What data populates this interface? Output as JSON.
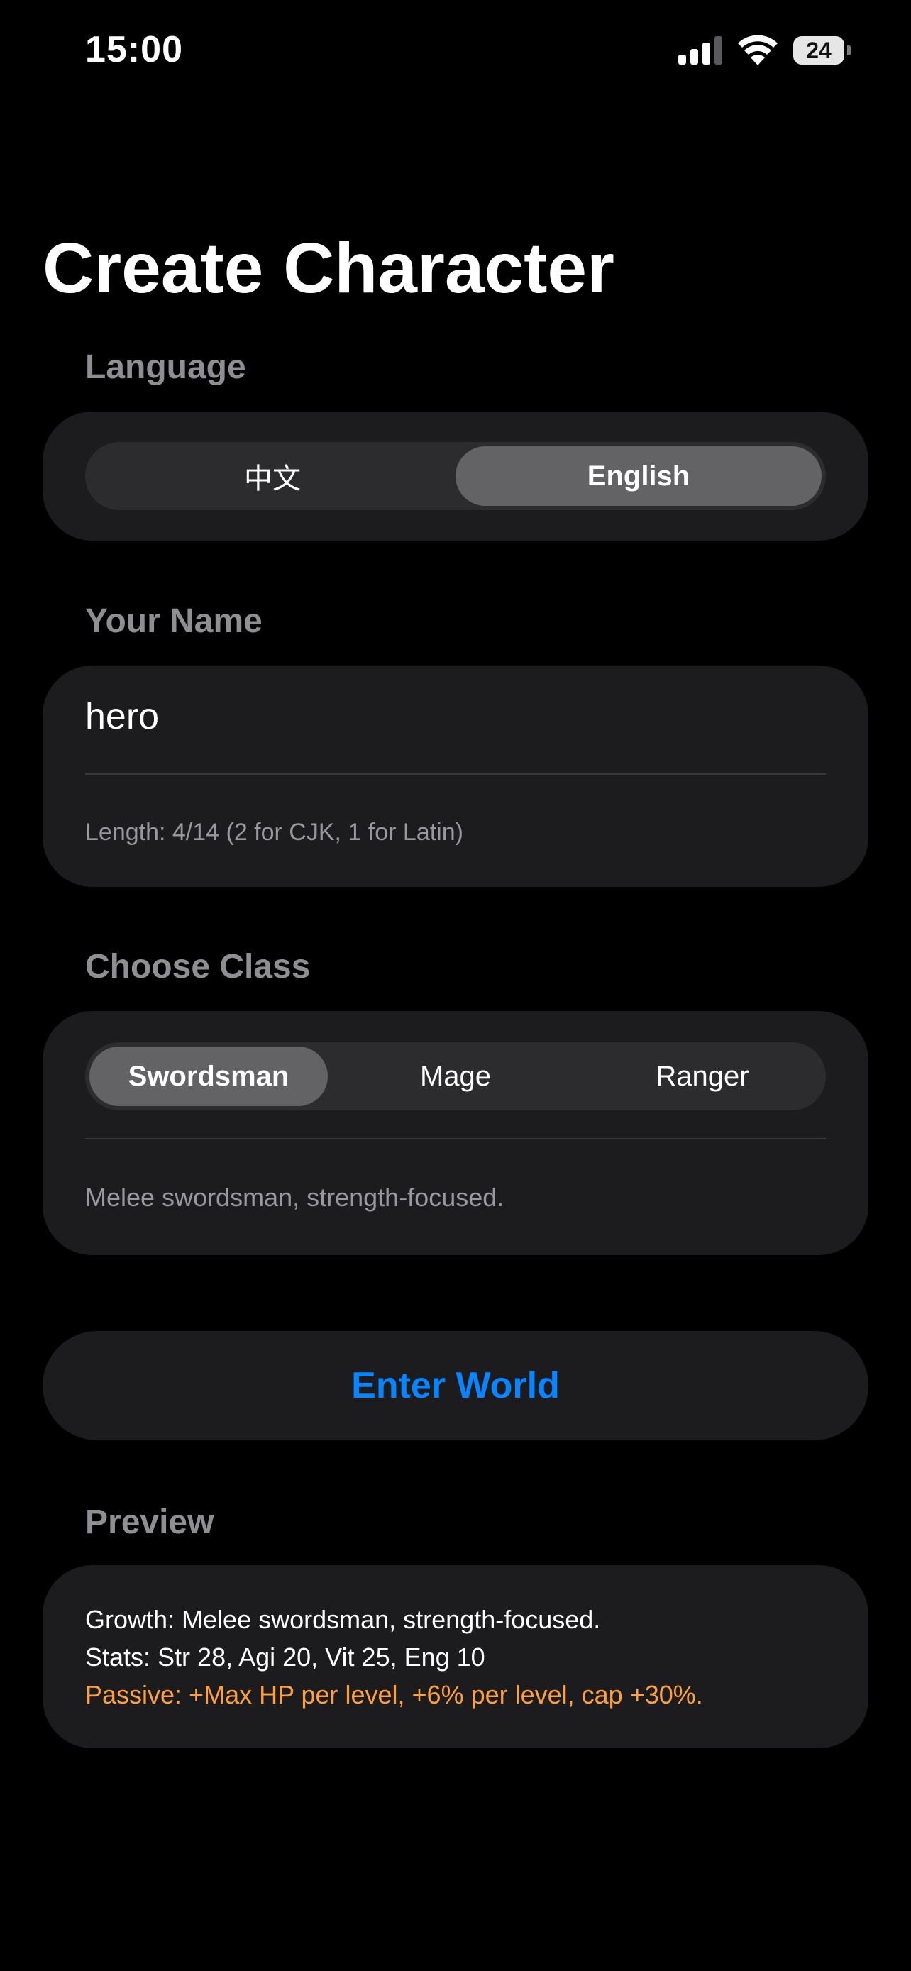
{
  "status_bar": {
    "time": "15:00",
    "battery": "24",
    "icons": [
      "signal-icon",
      "wifi-icon",
      "battery-icon"
    ]
  },
  "title": "Create Character",
  "language": {
    "label": "Language",
    "options": [
      "中文",
      "English"
    ],
    "selected": "English"
  },
  "name": {
    "label": "Your Name",
    "value": "hero",
    "hint": "Length: 4/14 (2 for CJK, 1 for Latin)"
  },
  "class": {
    "label": "Choose Class",
    "options": [
      "Swordsman",
      "Mage",
      "Ranger"
    ],
    "selected": "Swordsman",
    "description": "Melee swordsman, strength-focused."
  },
  "enter_button": {
    "label": "Enter World"
  },
  "preview": {
    "label": "Preview",
    "growth": "Growth: Melee swordsman, strength-focused.",
    "stats": "Stats: Str 28, Agi 20, Vit 25, Eng 10",
    "passive": "Passive: +Max HP per level, +6% per level, cap +30%."
  },
  "colors": {
    "background": "#000000",
    "card": "#1c1c1e",
    "segment_track": "#2c2c2e",
    "segment_selected": "#636366",
    "secondary_label": "#8e8e93",
    "accent": "#0a84ff",
    "passive": "#ff9f43"
  }
}
